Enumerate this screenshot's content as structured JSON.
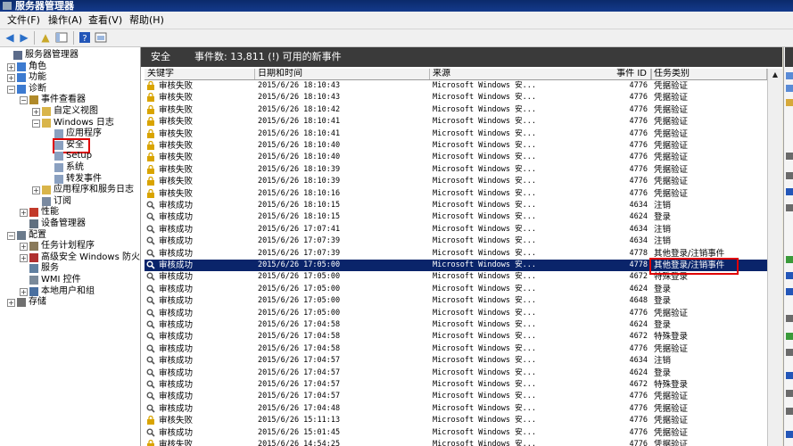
{
  "window": {
    "title": "服务器管理器"
  },
  "menu": [
    {
      "label": "文件(F)"
    },
    {
      "label": "操作(A)"
    },
    {
      "label": "查看(V)"
    },
    {
      "label": "帮助(H)"
    }
  ],
  "toolbar": {
    "icons": [
      "back-icon",
      "forward-icon",
      "up-folder-icon",
      "show-hide-tree-icon",
      "help-icon",
      "properties-icon"
    ]
  },
  "tree": [
    {
      "label": "服务器管理器",
      "indent": 0,
      "exp": "",
      "icon": "server-icon"
    },
    {
      "label": "角色",
      "indent": 1,
      "exp": "+",
      "icon": "roles-icon"
    },
    {
      "label": "功能",
      "indent": 1,
      "exp": "+",
      "icon": "features-icon"
    },
    {
      "label": "诊断",
      "indent": 1,
      "exp": "-",
      "icon": "diagnostics-icon"
    },
    {
      "label": "事件查看器",
      "indent": 2,
      "exp": "-",
      "icon": "event-viewer-icon"
    },
    {
      "label": "自定义视图",
      "indent": 3,
      "exp": "+",
      "icon": "folder-icon"
    },
    {
      "label": "Windows 日志",
      "indent": 3,
      "exp": "-",
      "icon": "folder-icon"
    },
    {
      "label": "应用程序",
      "indent": 4,
      "exp": "",
      "icon": "log-icon"
    },
    {
      "label": "安全",
      "indent": 4,
      "exp": "",
      "icon": "log-icon",
      "highlight": true
    },
    {
      "label": "Setup",
      "indent": 4,
      "exp": "",
      "icon": "log-icon"
    },
    {
      "label": "系统",
      "indent": 4,
      "exp": "",
      "icon": "log-icon"
    },
    {
      "label": "转发事件",
      "indent": 4,
      "exp": "",
      "icon": "log-icon"
    },
    {
      "label": "应用程序和服务日志",
      "indent": 3,
      "exp": "+",
      "icon": "folder-icon"
    },
    {
      "label": "订阅",
      "indent": 3,
      "exp": "",
      "icon": "subscription-icon"
    },
    {
      "label": "性能",
      "indent": 2,
      "exp": "+",
      "icon": "performance-icon"
    },
    {
      "label": "设备管理器",
      "indent": 2,
      "exp": "",
      "icon": "device-manager-icon"
    },
    {
      "label": "配置",
      "indent": 1,
      "exp": "-",
      "icon": "configuration-icon"
    },
    {
      "label": "任务计划程序",
      "indent": 2,
      "exp": "+",
      "icon": "task-scheduler-icon"
    },
    {
      "label": "高级安全 Windows 防火墙",
      "indent": 2,
      "exp": "+",
      "icon": "firewall-icon"
    },
    {
      "label": "服务",
      "indent": 2,
      "exp": "",
      "icon": "services-icon"
    },
    {
      "label": "WMI 控件",
      "indent": 2,
      "exp": "",
      "icon": "wmi-icon"
    },
    {
      "label": "本地用户和组",
      "indent": 2,
      "exp": "+",
      "icon": "users-icon"
    },
    {
      "label": "存储",
      "indent": 1,
      "exp": "+",
      "icon": "storage-icon"
    }
  ],
  "main": {
    "log_name": "安全",
    "event_count_text": "事件数: 13,811 (!) 可用的新事件",
    "columns": [
      {
        "label": "关键字"
      },
      {
        "label": "日期和时间"
      },
      {
        "label": "来源"
      },
      {
        "label": "事件 ID"
      },
      {
        "label": "任务类别"
      }
    ],
    "rows": [
      {
        "keyword": "审核失败",
        "datetime": "2015/6/26 18:10:43",
        "source": "Microsoft Windows 安...",
        "event_id": "4776",
        "task": "凭据验证",
        "type": "failure"
      },
      {
        "keyword": "审核失败",
        "datetime": "2015/6/26 18:10:43",
        "source": "Microsoft Windows 安...",
        "event_id": "4776",
        "task": "凭据验证",
        "type": "failure"
      },
      {
        "keyword": "审核失败",
        "datetime": "2015/6/26 18:10:42",
        "source": "Microsoft Windows 安...",
        "event_id": "4776",
        "task": "凭据验证",
        "type": "failure"
      },
      {
        "keyword": "审核失败",
        "datetime": "2015/6/26 18:10:41",
        "source": "Microsoft Windows 安...",
        "event_id": "4776",
        "task": "凭据验证",
        "type": "failure"
      },
      {
        "keyword": "审核失败",
        "datetime": "2015/6/26 18:10:41",
        "source": "Microsoft Windows 安...",
        "event_id": "4776",
        "task": "凭据验证",
        "type": "failure"
      },
      {
        "keyword": "审核失败",
        "datetime": "2015/6/26 18:10:40",
        "source": "Microsoft Windows 安...",
        "event_id": "4776",
        "task": "凭据验证",
        "type": "failure"
      },
      {
        "keyword": "审核失败",
        "datetime": "2015/6/26 18:10:40",
        "source": "Microsoft Windows 安...",
        "event_id": "4776",
        "task": "凭据验证",
        "type": "failure"
      },
      {
        "keyword": "审核失败",
        "datetime": "2015/6/26 18:10:39",
        "source": "Microsoft Windows 安...",
        "event_id": "4776",
        "task": "凭据验证",
        "type": "failure"
      },
      {
        "keyword": "审核失败",
        "datetime": "2015/6/26 18:10:39",
        "source": "Microsoft Windows 安...",
        "event_id": "4776",
        "task": "凭据验证",
        "type": "failure"
      },
      {
        "keyword": "审核失败",
        "datetime": "2015/6/26 18:10:16",
        "source": "Microsoft Windows 安...",
        "event_id": "4776",
        "task": "凭据验证",
        "type": "failure"
      },
      {
        "keyword": "审核成功",
        "datetime": "2015/6/26 18:10:15",
        "source": "Microsoft Windows 安...",
        "event_id": "4634",
        "task": "注销",
        "type": "success"
      },
      {
        "keyword": "审核成功",
        "datetime": "2015/6/26 18:10:15",
        "source": "Microsoft Windows 安...",
        "event_id": "4624",
        "task": "登录",
        "type": "success"
      },
      {
        "keyword": "审核成功",
        "datetime": "2015/6/26 17:07:41",
        "source": "Microsoft Windows 安...",
        "event_id": "4634",
        "task": "注销",
        "type": "success"
      },
      {
        "keyword": "审核成功",
        "datetime": "2015/6/26 17:07:39",
        "source": "Microsoft Windows 安...",
        "event_id": "4634",
        "task": "注销",
        "type": "success"
      },
      {
        "keyword": "审核成功",
        "datetime": "2015/6/26 17:07:39",
        "source": "Microsoft Windows 安...",
        "event_id": "4778",
        "task": "其他登录/注销事件",
        "type": "success"
      },
      {
        "keyword": "审核成功",
        "datetime": "2015/6/26 17:05:00",
        "source": "Microsoft Windows 安...",
        "event_id": "4778",
        "task": "其他登录/注销事件",
        "type": "success",
        "selected": true
      },
      {
        "keyword": "审核成功",
        "datetime": "2015/6/26 17:05:00",
        "source": "Microsoft Windows 安...",
        "event_id": "4672",
        "task": "特殊登录",
        "type": "success"
      },
      {
        "keyword": "审核成功",
        "datetime": "2015/6/26 17:05:00",
        "source": "Microsoft Windows 安...",
        "event_id": "4624",
        "task": "登录",
        "type": "success"
      },
      {
        "keyword": "审核成功",
        "datetime": "2015/6/26 17:05:00",
        "source": "Microsoft Windows 安...",
        "event_id": "4648",
        "task": "登录",
        "type": "success"
      },
      {
        "keyword": "审核成功",
        "datetime": "2015/6/26 17:05:00",
        "source": "Microsoft Windows 安...",
        "event_id": "4776",
        "task": "凭据验证",
        "type": "success"
      },
      {
        "keyword": "审核成功",
        "datetime": "2015/6/26 17:04:58",
        "source": "Microsoft Windows 安...",
        "event_id": "4624",
        "task": "登录",
        "type": "success"
      },
      {
        "keyword": "审核成功",
        "datetime": "2015/6/26 17:04:58",
        "source": "Microsoft Windows 安...",
        "event_id": "4672",
        "task": "特殊登录",
        "type": "success"
      },
      {
        "keyword": "审核成功",
        "datetime": "2015/6/26 17:04:58",
        "source": "Microsoft Windows 安...",
        "event_id": "4776",
        "task": "凭据验证",
        "type": "success"
      },
      {
        "keyword": "审核成功",
        "datetime": "2015/6/26 17:04:57",
        "source": "Microsoft Windows 安...",
        "event_id": "4634",
        "task": "注销",
        "type": "success"
      },
      {
        "keyword": "审核成功",
        "datetime": "2015/6/26 17:04:57",
        "source": "Microsoft Windows 安...",
        "event_id": "4624",
        "task": "登录",
        "type": "success"
      },
      {
        "keyword": "审核成功",
        "datetime": "2015/6/26 17:04:57",
        "source": "Microsoft Windows 安...",
        "event_id": "4672",
        "task": "特殊登录",
        "type": "success"
      },
      {
        "keyword": "审核成功",
        "datetime": "2015/6/26 17:04:57",
        "source": "Microsoft Windows 安...",
        "event_id": "4776",
        "task": "凭据验证",
        "type": "success"
      },
      {
        "keyword": "审核成功",
        "datetime": "2015/6/26 17:04:48",
        "source": "Microsoft Windows 安...",
        "event_id": "4776",
        "task": "凭据验证",
        "type": "success"
      },
      {
        "keyword": "审核失败",
        "datetime": "2015/6/26 15:11:13",
        "source": "Microsoft Windows 安...",
        "event_id": "4776",
        "task": "凭据验证",
        "type": "failure"
      },
      {
        "keyword": "审核成功",
        "datetime": "2015/6/26 15:01:45",
        "source": "Microsoft Windows 安...",
        "event_id": "4776",
        "task": "凭据验证",
        "type": "success"
      },
      {
        "keyword": "审核失败",
        "datetime": "2015/6/26 14:54:25",
        "source": "Microsoft Windows 安...",
        "event_id": "4776",
        "task": "凭据验证",
        "type": "failure"
      }
    ]
  },
  "colors": {
    "selection": "#0a246a",
    "highlight_box": "#e00000",
    "failure_icon": "#d9a400",
    "success_icon": "#555555"
  }
}
